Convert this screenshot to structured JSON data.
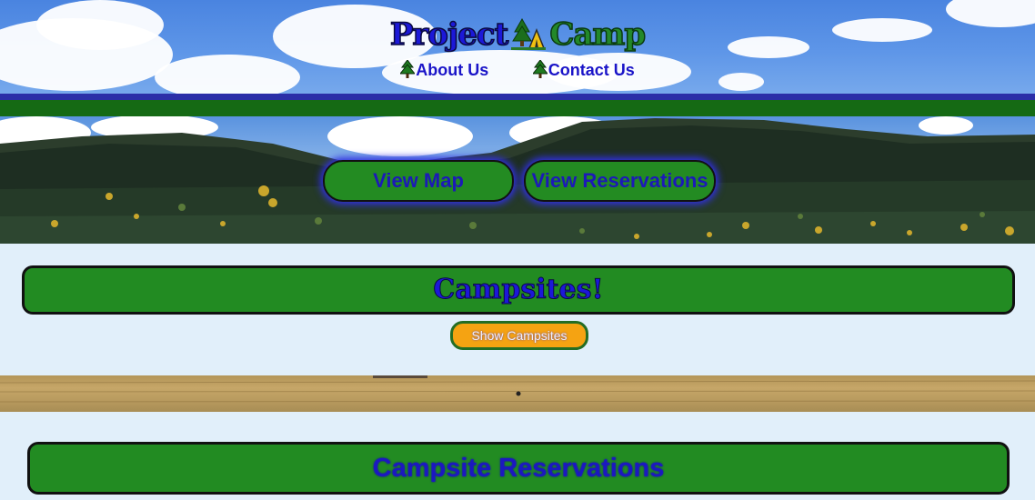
{
  "header": {
    "logo_part1": "Project",
    "logo_part2": "Camp",
    "logo_icon": "tent-icon",
    "nav": [
      {
        "label": "About Us",
        "icon": "tree-icon"
      },
      {
        "label": "Contact Us",
        "icon": "tree-icon"
      }
    ]
  },
  "hero": {
    "view_map_label": "View Map",
    "view_reservations_label": "View Reservations"
  },
  "campsites": {
    "title": "Campsites!",
    "show_button_label": "Show Campsites"
  },
  "reservations": {
    "title": "Campsite Reservations"
  },
  "colors": {
    "brand_blue": "#1c18d8",
    "brand_green": "#228b22",
    "page_bg": "#e1effa",
    "accent_orange": "#f5a312"
  }
}
